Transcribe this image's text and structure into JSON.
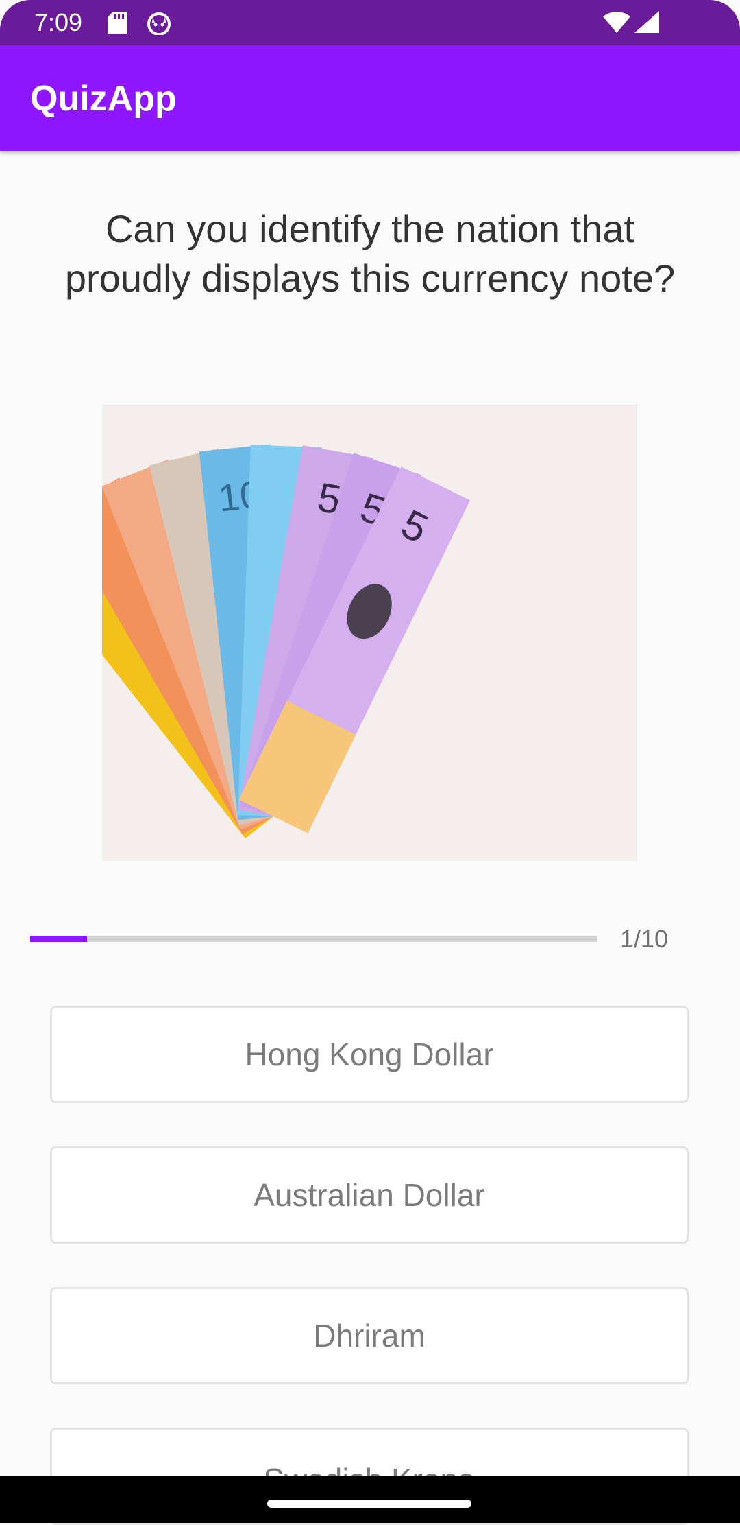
{
  "status_bar": {
    "time": "7:09",
    "icons": [
      "sd-card-icon",
      "cat-notification-icon",
      "wifi-icon",
      "cell-signal-icon"
    ],
    "background_color": "#6a1b9a"
  },
  "app_bar": {
    "title": "QuizApp",
    "background_color": "#8e17ff"
  },
  "quiz": {
    "question": "Can you identify the nation that proudly displays this currency note?",
    "image_alt": "",
    "progress": {
      "current": 1,
      "total": 10,
      "label": "1/10",
      "fraction": 0.1,
      "fill_color": "#8e17ff"
    },
    "options": [
      {
        "label": "Hong Kong Dollar"
      },
      {
        "label": "Australian Dollar"
      },
      {
        "label": "Dhriram"
      },
      {
        "label": "Swedish Krona"
      }
    ]
  }
}
